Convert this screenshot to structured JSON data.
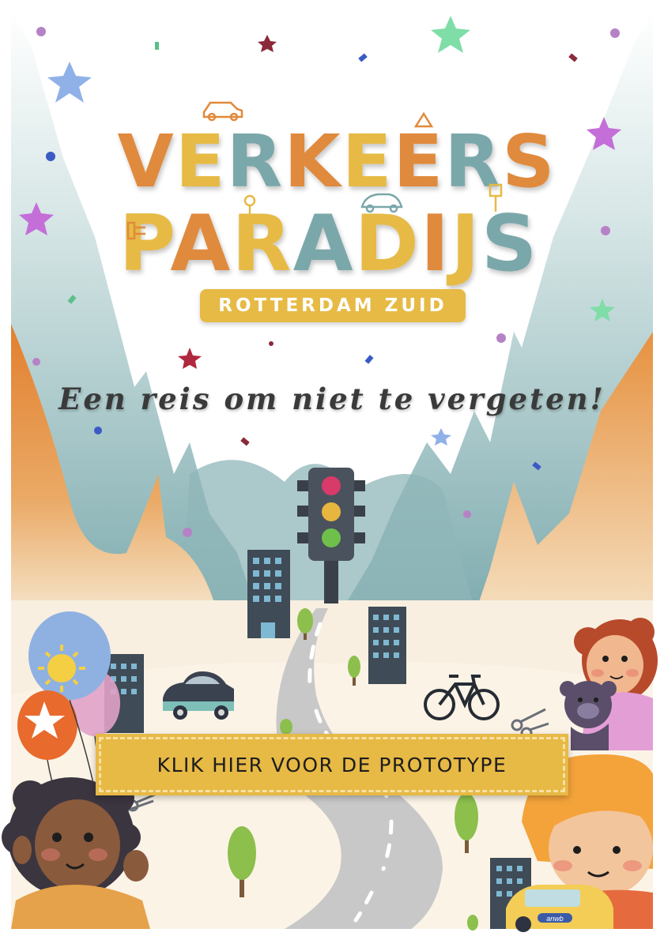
{
  "poster": {
    "title_line1": "VERKEERS",
    "title_line2": "PARADIJS",
    "subtitle": "ROTTERDAM ZUID",
    "tagline": "Een reis om niet te vergeten!",
    "cta_label": "KLIK HIER VOOR DE PROTOTYPE",
    "car_badge": "anwb"
  },
  "colors": {
    "orange": "#e08a3c",
    "mustard": "#e6ba45",
    "teal": "#7aa7aa",
    "mountain_orange": "#e49a4c",
    "mountain_teal": "#8db3b5",
    "ground": "#f7efe1"
  },
  "icons": [
    "star-icon",
    "traffic-light-icon",
    "car-icon",
    "bicycle-icon",
    "scissors-icon",
    "balloon-icon",
    "tree-icon",
    "building-icon"
  ]
}
